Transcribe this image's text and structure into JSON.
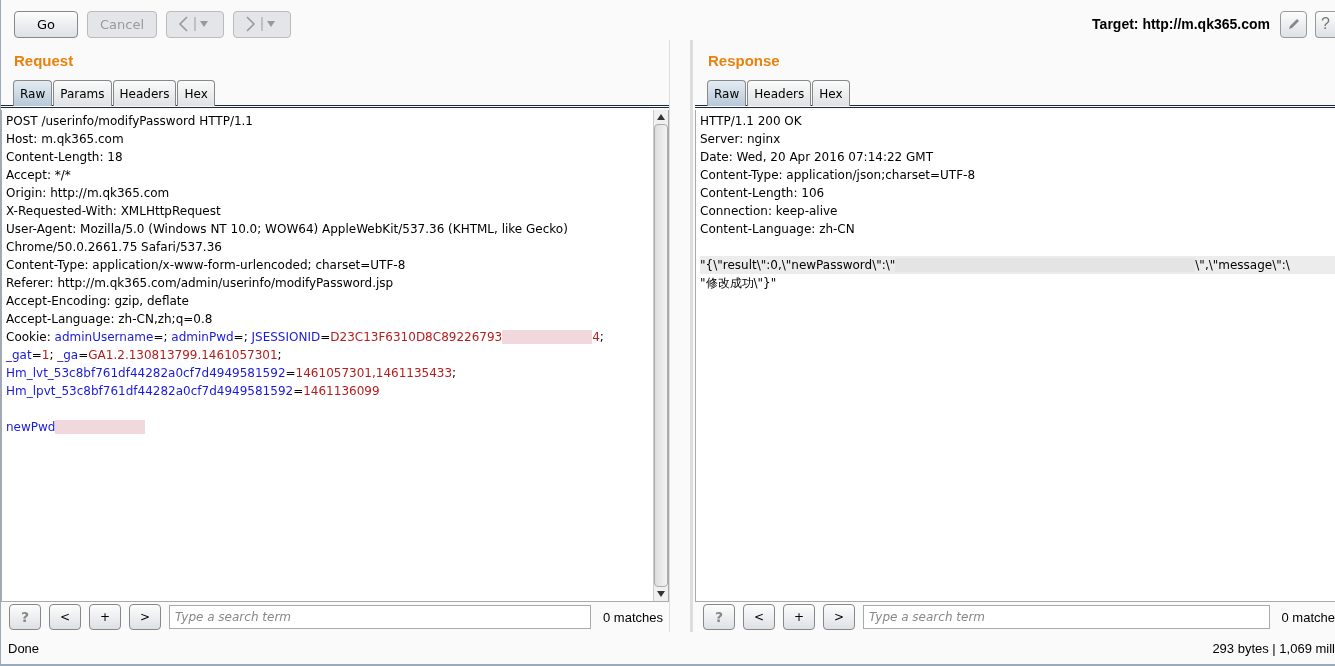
{
  "toolbar": {
    "buttons": [
      {
        "kind": "text",
        "label": "Go",
        "disabled": false
      },
      {
        "kind": "text",
        "label": "Cancel",
        "disabled": true
      },
      {
        "kind": "back",
        "disabled": true
      },
      {
        "kind": "forward",
        "disabled": true
      }
    ],
    "target": "Target: http://m.qk365.com",
    "help": "?"
  },
  "panes": [
    {
      "kind": "request",
      "title": "Request",
      "tabs": [
        {
          "label": "Raw",
          "selected": true
        },
        {
          "label": "Params",
          "selected": false
        },
        {
          "label": "Headers",
          "selected": false
        },
        {
          "label": "Hex",
          "selected": false
        }
      ],
      "lines": [
        {
          "current": false,
          "segments": [
            {
              "kind": "plain",
              "text": "POST /userinfo/modifyPassword HTTP/1.1"
            }
          ]
        },
        {
          "current": false,
          "segments": [
            {
              "kind": "plain",
              "text": "Host: m.qk365.com"
            }
          ]
        },
        {
          "current": false,
          "segments": [
            {
              "kind": "plain",
              "text": "Content-Length: 18"
            }
          ]
        },
        {
          "current": false,
          "segments": [
            {
              "kind": "plain",
              "text": "Accept: */*"
            }
          ]
        },
        {
          "current": false,
          "segments": [
            {
              "kind": "plain",
              "text": "Origin: http://m.qk365.com"
            }
          ]
        },
        {
          "current": false,
          "segments": [
            {
              "kind": "plain",
              "text": "X-Requested-With: XMLHttpRequest"
            }
          ]
        },
        {
          "current": false,
          "segments": [
            {
              "kind": "plain",
              "text": "User-Agent: Mozilla/5.0 (Windows NT 10.0; WOW64) AppleWebKit/537.36 (KHTML, like Gecko)"
            }
          ]
        },
        {
          "current": false,
          "segments": [
            {
              "kind": "plain",
              "text": "Chrome/50.0.2661.75 Safari/537.36"
            }
          ]
        },
        {
          "current": false,
          "segments": [
            {
              "kind": "plain",
              "text": "Content-Type: application/x-www-form-urlencoded; charset=UTF-8"
            }
          ]
        },
        {
          "current": false,
          "segments": [
            {
              "kind": "plain",
              "text": "Referer: http://m.qk365.com/admin/userinfo/modifyPassword.jsp"
            }
          ]
        },
        {
          "current": false,
          "segments": [
            {
              "kind": "plain",
              "text": "Accept-Encoding: gzip, deflate"
            }
          ]
        },
        {
          "current": false,
          "segments": [
            {
              "kind": "plain",
              "text": "Accept-Language: zh-CN,zh;q=0.8"
            }
          ]
        },
        {
          "current": false,
          "segments": [
            {
              "kind": "plain",
              "text": "Cookie: "
            },
            {
              "kind": "name",
              "text": "adminUsername"
            },
            {
              "kind": "plain",
              "text": "=; "
            },
            {
              "kind": "name",
              "text": "adminPwd"
            },
            {
              "kind": "plain",
              "text": "=; "
            },
            {
              "kind": "name",
              "text": "JSESSIONID"
            },
            {
              "kind": "plain",
              "text": "="
            },
            {
              "kind": "value",
              "text": "D23C13F6310D8C89226793"
            },
            {
              "kind": "redacted"
            },
            {
              "kind": "value",
              "text": "4"
            },
            {
              "kind": "plain",
              "text": ";"
            }
          ]
        },
        {
          "current": false,
          "segments": [
            {
              "kind": "name",
              "text": "_gat"
            },
            {
              "kind": "plain",
              "text": "="
            },
            {
              "kind": "value",
              "text": "1"
            },
            {
              "kind": "plain",
              "text": "; "
            },
            {
              "kind": "name",
              "text": "_ga"
            },
            {
              "kind": "plain",
              "text": "="
            },
            {
              "kind": "value",
              "text": "GA1.2.130813799.1461057301"
            },
            {
              "kind": "plain",
              "text": ";"
            }
          ]
        },
        {
          "current": false,
          "segments": [
            {
              "kind": "name",
              "text": "Hm_lvt_53c8bf761df44282a0cf7d4949581592"
            },
            {
              "kind": "plain",
              "text": "="
            },
            {
              "kind": "value",
              "text": "1461057301,1461135433"
            },
            {
              "kind": "plain",
              "text": ";"
            }
          ]
        },
        {
          "current": false,
          "segments": [
            {
              "kind": "name",
              "text": "Hm_lpvt_53c8bf761df44282a0cf7d4949581592"
            },
            {
              "kind": "plain",
              "text": "="
            },
            {
              "kind": "value",
              "text": "1461136099"
            }
          ]
        },
        {
          "current": false
        },
        {
          "current": false,
          "segments": [
            {
              "kind": "name",
              "text": "newPwd"
            },
            {
              "kind": "redacted"
            }
          ]
        }
      ],
      "search": {
        "buttons": [
          "?",
          "<",
          "+",
          ">"
        ],
        "placeholder": "Type a search term",
        "matches": "0 matches"
      }
    },
    {
      "kind": "response",
      "title": "Response",
      "tabs": [
        {
          "label": "Raw",
          "selected": true
        },
        {
          "label": "Headers",
          "selected": false
        },
        {
          "label": "Hex",
          "selected": false
        }
      ],
      "lines": [
        {
          "current": false,
          "segments": [
            {
              "kind": "plain",
              "text": "HTTP/1.1 200 OK"
            }
          ]
        },
        {
          "current": false,
          "segments": [
            {
              "kind": "plain",
              "text": "Server: nginx"
            }
          ]
        },
        {
          "current": false,
          "segments": [
            {
              "kind": "plain",
              "text": "Date: Wed, 20 Apr 2016 07:14:22 GMT"
            }
          ]
        },
        {
          "current": false,
          "segments": [
            {
              "kind": "plain",
              "text": "Content-Type: application/json;charset=UTF-8"
            }
          ]
        },
        {
          "current": false,
          "segments": [
            {
              "kind": "plain",
              "text": "Content-Length: 106"
            }
          ]
        },
        {
          "current": false,
          "segments": [
            {
              "kind": "plain",
              "text": "Connection: keep-alive"
            }
          ]
        },
        {
          "current": false,
          "segments": [
            {
              "kind": "plain",
              "text": "Content-Language: zh-CN"
            }
          ]
        },
        {
          "current": false
        },
        {
          "current": true,
          "segments": [
            {
              "kind": "plain",
              "text": "\"{\\\"result\\\":0,\\\"newPassword\\\":\\\""
            },
            {
              "kind": "redacted"
            },
            {
              "kind": "plain",
              "text": "\\\",\\\"message\\\":\\"
            }
          ]
        },
        {
          "current": false,
          "segments": [
            {
              "kind": "plain",
              "text": "\"修改成功\\\"}\""
            }
          ]
        }
      ],
      "search": {
        "buttons": [
          "?",
          "<",
          "+",
          ">"
        ],
        "placeholder": "Type a search term",
        "matches": "0 matche"
      }
    }
  ],
  "status": {
    "left": "Done",
    "right": "293 bytes | 1,069 mill"
  }
}
